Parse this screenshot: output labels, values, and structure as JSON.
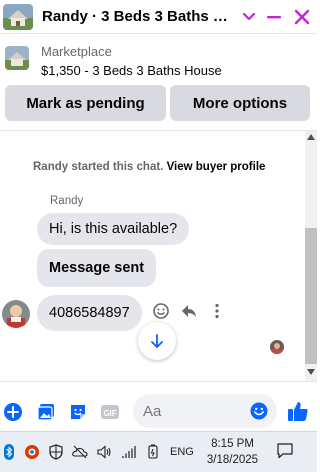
{
  "header": {
    "title": "Randy · 3 Beds 3 Baths Ho...",
    "accent_color": "#c026d3"
  },
  "marketplace": {
    "kicker": "Marketplace",
    "listing": "$1,350 - 3 Beds 3 Baths House"
  },
  "actions": {
    "pending_label": "Mark as pending",
    "more_label": "More options"
  },
  "chat": {
    "started_text": "Randy started this chat.",
    "view_profile_label": "View buyer profile",
    "sender_name": "Randy",
    "messages": [
      "Hi, is this available?",
      "Message sent",
      "4086584897"
    ]
  },
  "composer": {
    "placeholder": "Aa",
    "brand_color": "#0866ff"
  },
  "taskbar": {
    "language": "ENG",
    "time": "8:15 PM",
    "date": "3/18/2025"
  }
}
